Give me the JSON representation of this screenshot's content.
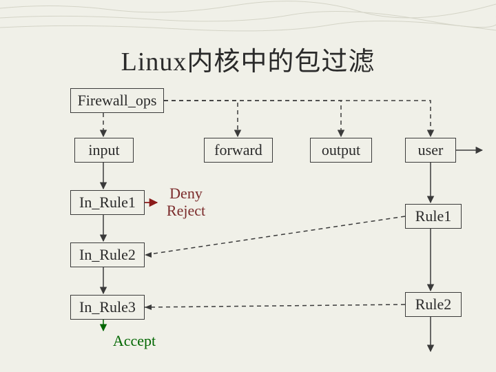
{
  "title": "Linux内核中的包过滤",
  "nodes": {
    "firewall_ops": "Firewall_ops",
    "input": "input",
    "forward": "forward",
    "output": "output",
    "user": "user",
    "in_rule1": "In_Rule1",
    "in_rule2": "In_Rule2",
    "in_rule3": "In_Rule3",
    "rule1": "Rule1",
    "rule2": "Rule2"
  },
  "labels": {
    "deny": "Deny",
    "reject": "Reject",
    "accept": "Accept"
  }
}
